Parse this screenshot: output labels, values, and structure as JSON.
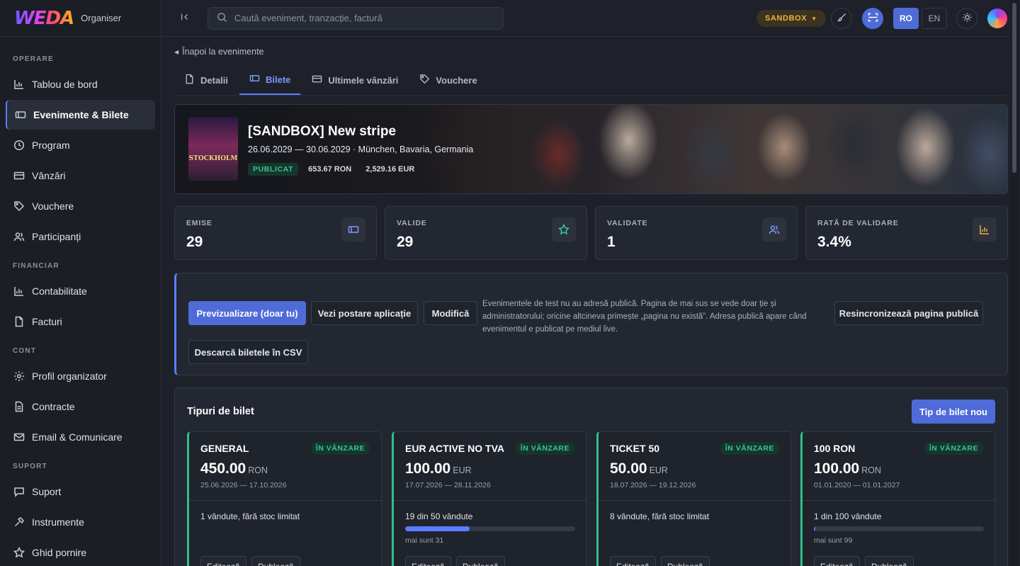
{
  "brand": {
    "logo": "WEDA",
    "subtitle": "Organiser"
  },
  "sidebar": {
    "sections": [
      {
        "label": "OPERARE",
        "items": [
          {
            "label": "Tablou de bord",
            "icon": "chart-icon"
          },
          {
            "label": "Evenimente & Bilete",
            "icon": "ticket-icon",
            "active": true
          },
          {
            "label": "Program",
            "icon": "clock-icon"
          },
          {
            "label": "Vânzări",
            "icon": "card-icon"
          },
          {
            "label": "Vouchere",
            "icon": "tag-icon"
          },
          {
            "label": "Participanți",
            "icon": "users-icon"
          }
        ]
      },
      {
        "label": "FINANCIAR",
        "items": [
          {
            "label": "Contabilitate",
            "icon": "chart-icon"
          },
          {
            "label": "Facturi",
            "icon": "file-icon"
          }
        ]
      },
      {
        "label": "CONT",
        "items": [
          {
            "label": "Profil organizator",
            "icon": "gear-icon"
          },
          {
            "label": "Contracte",
            "icon": "doc-icon"
          },
          {
            "label": "Email & Comunicare",
            "icon": "mail-icon"
          }
        ]
      },
      {
        "label": "SUPORT",
        "items": [
          {
            "label": "Suport",
            "icon": "chat-icon"
          },
          {
            "label": "Instrumente",
            "icon": "hammer-icon"
          },
          {
            "label": "Ghid pornire",
            "icon": "star-icon"
          }
        ]
      }
    ]
  },
  "topbar": {
    "search_placeholder": "Caută eveniment, tranzacție, factură",
    "env_label": "SANDBOX",
    "lang_ro": "RO",
    "lang_en": "EN"
  },
  "main": {
    "back_label": "Înapoi la evenimente",
    "tabs": [
      {
        "label": "Detalii"
      },
      {
        "label": "Bilete",
        "active": true
      },
      {
        "label": "Ultimele vânzări"
      },
      {
        "label": "Vouchere"
      }
    ]
  },
  "event": {
    "poster_text": "STOCKHOLM",
    "title": "[SANDBOX] New stripe",
    "subtitle": "26.06.2029 — 30.06.2029 · München, Bavaria, Germania",
    "status": "PUBLICAT",
    "revenue_ron": "653.67 RON",
    "revenue_eur": "2,529.16 EUR"
  },
  "stats": [
    {
      "label": "EMISE",
      "value": "29",
      "icon": "ticket-icon"
    },
    {
      "label": "VALIDE",
      "value": "29",
      "icon": "star-icon"
    },
    {
      "label": "VALIDATE",
      "value": "1",
      "icon": "users-icon"
    },
    {
      "label": "RATĂ DE VALIDARE",
      "value": "3.4%",
      "icon": "chart-icon"
    }
  ],
  "actions": {
    "preview": "Previzualizare (doar tu)",
    "app_post": "Vezi postare aplicație",
    "edit": "Modifică",
    "note": "Evenimentele de test nu au adresă publică. Pagina de mai sus se vede doar ție și administratorului; oricine altcineva primește „pagina nu există”. Adresa publică apare când evenimentul e publicat pe mediul live.",
    "resync": "Resincronizează pagina publică",
    "download_csv": "Descarcă biletele în CSV"
  },
  "ticket_types": {
    "title": "Tipuri de bilet",
    "new_button": "Tip de bilet nou",
    "cards": [
      {
        "name": "GENERAL",
        "badge": "ÎN VÂNZARE",
        "price": "450.00",
        "currency": "RON",
        "dates": "25.06.2026 — 17.10.2026",
        "sold": "1 vândute, fără stoc limitat",
        "left": "",
        "progress": null,
        "edit": "Editează",
        "delete": "Dublează"
      },
      {
        "name": "EUR ACTIVE NO TVA",
        "badge": "ÎN VÂNZARE",
        "price": "100.00",
        "currency": "EUR",
        "dates": "17.07.2026 — 28.11.2026",
        "sold": "19 din 50 vândute",
        "left": "mai sunt 31",
        "progress": 0.38,
        "edit": "Editează",
        "delete": "Dublează"
      },
      {
        "name": "TICKET 50",
        "badge": "ÎN VÂNZARE",
        "price": "50.00",
        "currency": "EUR",
        "dates": "18.07.2026 — 19.12.2026",
        "sold": "8 vândute, fără stoc limitat",
        "left": "",
        "progress": null,
        "edit": "Editează",
        "delete": "Dublează"
      },
      {
        "name": "100 RON",
        "badge": "ÎN VÂNZARE",
        "price": "100.00",
        "currency": "RON",
        "dates": "01.01.2020 — 01.01.2027",
        "sold": "1 din 100 vândute",
        "left": "mai sunt 99",
        "progress": 0.01,
        "edit": "Editează",
        "delete": "Dublează"
      }
    ]
  },
  "colors": {
    "accent": "#5a7fff",
    "success": "#35c78f",
    "warning": "#e7b53c",
    "background": "#1e2129"
  }
}
